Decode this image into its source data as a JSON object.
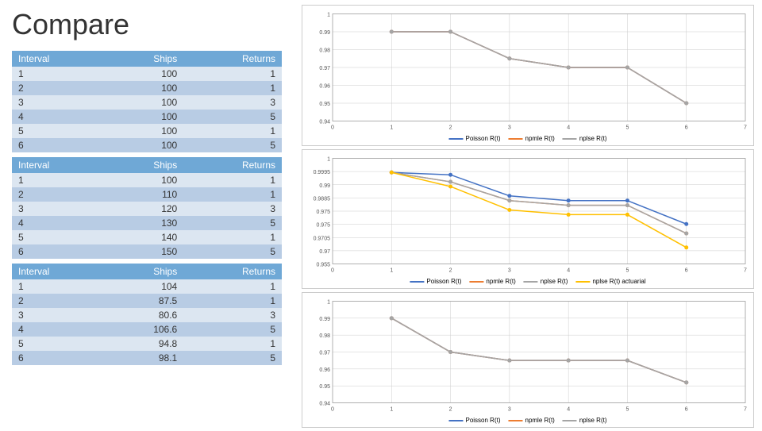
{
  "title": "Compare",
  "tables": [
    {
      "id": "table1",
      "headers": [
        "Interval",
        "Ships",
        "Returns"
      ],
      "rows": [
        [
          "1",
          "100",
          "1"
        ],
        [
          "2",
          "100",
          "1"
        ],
        [
          "3",
          "100",
          "3"
        ],
        [
          "4",
          "100",
          "5"
        ],
        [
          "5",
          "100",
          "1"
        ],
        [
          "6",
          "100",
          "5"
        ]
      ]
    },
    {
      "id": "table2",
      "headers": [
        "Interval",
        "Ships",
        "Returns"
      ],
      "rows": [
        [
          "1",
          "100",
          "1"
        ],
        [
          "2",
          "110",
          "1"
        ],
        [
          "3",
          "120",
          "3"
        ],
        [
          "4",
          "130",
          "5"
        ],
        [
          "5",
          "140",
          "1"
        ],
        [
          "6",
          "150",
          "5"
        ]
      ]
    },
    {
      "id": "table3",
      "headers": [
        "Interval",
        "Ships",
        "Returns"
      ],
      "rows": [
        [
          "1",
          "104",
          "1"
        ],
        [
          "2",
          "87.5",
          "1"
        ],
        [
          "3",
          "80.6",
          "3"
        ],
        [
          "4",
          "106.6",
          "5"
        ],
        [
          "5",
          "94.8",
          "1"
        ],
        [
          "6",
          "98.1",
          "5"
        ]
      ]
    }
  ],
  "charts": [
    {
      "id": "chart1",
      "ymin": 0.94,
      "ymax": 1.0,
      "yticks": [
        "1",
        "0.99",
        "0.98",
        "0.97",
        "0.96",
        "0.95",
        "0.94"
      ],
      "xticks": [
        "0",
        "1",
        "2",
        "3",
        "4",
        "5",
        "6",
        "7"
      ],
      "series": [
        {
          "name": "Poisson R(t)",
          "color": "#4472c4",
          "points": [
            [
              1,
              0.99
            ],
            [
              2,
              0.99
            ],
            [
              3,
              0.975
            ],
            [
              4,
              0.97
            ],
            [
              5,
              0.97
            ],
            [
              6,
              0.95
            ]
          ]
        },
        {
          "name": "npmle R(t)",
          "color": "#ed7d31",
          "points": [
            [
              1,
              0.99
            ],
            [
              2,
              0.99
            ],
            [
              3,
              0.975
            ],
            [
              4,
              0.97
            ],
            [
              5,
              0.97
            ],
            [
              6,
              0.95
            ]
          ]
        },
        {
          "name": "nplse R(t)",
          "color": "#a5a5a5",
          "points": [
            [
              1,
              0.99
            ],
            [
              2,
              0.99
            ],
            [
              3,
              0.975
            ],
            [
              4,
              0.97
            ],
            [
              5,
              0.97
            ],
            [
              6,
              0.95
            ]
          ]
        }
      ]
    },
    {
      "id": "chart2",
      "ymin": 0.955,
      "ymax": 1.0,
      "yticks": [
        "1",
        "0.9995",
        "0.99",
        "0.9885",
        "0.975",
        "0.975",
        "0.9705",
        "0.97",
        "0.955"
      ],
      "xticks": [
        "0",
        "1",
        "2",
        "3",
        "4",
        "5",
        "6",
        "7"
      ],
      "series": [
        {
          "name": "Poisson R(t)",
          "color": "#4472c4",
          "points": [
            [
              1,
              0.994
            ],
            [
              2,
              0.993
            ],
            [
              3,
              0.984
            ],
            [
              4,
              0.982
            ],
            [
              5,
              0.982
            ],
            [
              6,
              0.972
            ]
          ]
        },
        {
          "name": "npmle R(t)",
          "color": "#ed7d31",
          "points": [
            [
              1,
              0.994
            ],
            [
              2,
              0.99
            ],
            [
              3,
              0.982
            ],
            [
              4,
              0.98
            ],
            [
              5,
              0.98
            ],
            [
              6,
              0.968
            ]
          ]
        },
        {
          "name": "nplse R(t)",
          "color": "#a5a5a5",
          "points": [
            [
              1,
              0.994
            ],
            [
              2,
              0.99
            ],
            [
              3,
              0.982
            ],
            [
              4,
              0.98
            ],
            [
              5,
              0.98
            ],
            [
              6,
              0.968
            ]
          ]
        },
        {
          "name": "nplse R(t) actuarial",
          "color": "#ffc000",
          "points": [
            [
              1,
              0.994
            ],
            [
              2,
              0.988
            ],
            [
              3,
              0.978
            ],
            [
              4,
              0.976
            ],
            [
              5,
              0.976
            ],
            [
              6,
              0.962
            ]
          ]
        }
      ]
    },
    {
      "id": "chart3",
      "ymin": 0.94,
      "ymax": 1.0,
      "yticks": [
        "1",
        "0.99",
        "0.98",
        "0.97",
        "0.96",
        "0.95",
        "0.94"
      ],
      "xticks": [
        "0",
        "1",
        "2",
        "3",
        "4",
        "5",
        "6",
        "7"
      ],
      "series": [
        {
          "name": "Poisson R(t)",
          "color": "#4472c4",
          "points": [
            [
              1,
              0.99
            ],
            [
              2,
              0.97
            ],
            [
              3,
              0.965
            ],
            [
              4,
              0.965
            ],
            [
              5,
              0.965
            ],
            [
              6,
              0.952
            ]
          ]
        },
        {
          "name": "npmle R(t)",
          "color": "#ed7d31",
          "points": [
            [
              1,
              0.99
            ],
            [
              2,
              0.97
            ],
            [
              3,
              0.965
            ],
            [
              4,
              0.965
            ],
            [
              5,
              0.965
            ],
            [
              6,
              0.952
            ]
          ]
        },
        {
          "name": "nplse R(t)",
          "color": "#a5a5a5",
          "points": [
            [
              1,
              0.99
            ],
            [
              2,
              0.97
            ],
            [
              3,
              0.965
            ],
            [
              4,
              0.965
            ],
            [
              5,
              0.965
            ],
            [
              6,
              0.952
            ]
          ]
        }
      ]
    }
  ]
}
